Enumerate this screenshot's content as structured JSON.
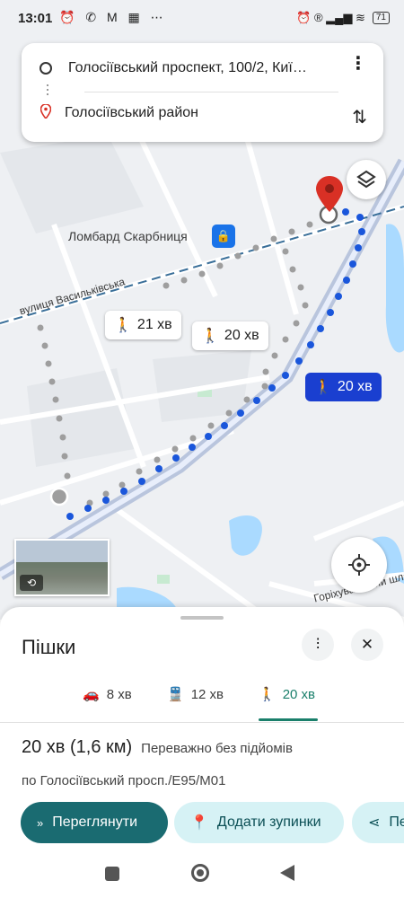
{
  "status_bar": {
    "time": "13:01",
    "left_icons": "⏰ ✆ M ▦ ⋯",
    "right_icons": "⏰ ® ▂▄▆ ≋",
    "battery": "71"
  },
  "search": {
    "origin": "Голосіївський проспект, 100/2, Киї…",
    "destination": "Голосіївський район"
  },
  "map": {
    "poi_label": "Ломбард Скарбниця",
    "street_vasylkivska": "вулиця Васильківська",
    "street_horikhuvatskyi": "Горіхуватський шлях",
    "route_labels": [
      {
        "time": "21 хв",
        "active": false
      },
      {
        "time": "20 хв",
        "active": false
      },
      {
        "time": "20 хв",
        "active": true
      }
    ],
    "colors": {
      "route_active": "#1a56db",
      "route_alt": "#9e9e9e",
      "pin": "#d93025",
      "water": "#aadaff",
      "park": "#c7ead1"
    }
  },
  "sheet": {
    "title": "Пішки",
    "tabs": [
      {
        "icon": "car-icon",
        "label": "8 хв"
      },
      {
        "icon": "transit-icon",
        "label": "12 хв"
      },
      {
        "icon": "walk-icon",
        "label": "20 хв",
        "active": true
      }
    ],
    "duration": "20 хв (1,6 км)",
    "terrain_note": "Переважно без підйомів",
    "via": "по Голосіївський просп./E95/M01",
    "buttons": {
      "preview": "Переглянути",
      "add_stops": "Додати зупинки",
      "share": "Пе"
    }
  }
}
